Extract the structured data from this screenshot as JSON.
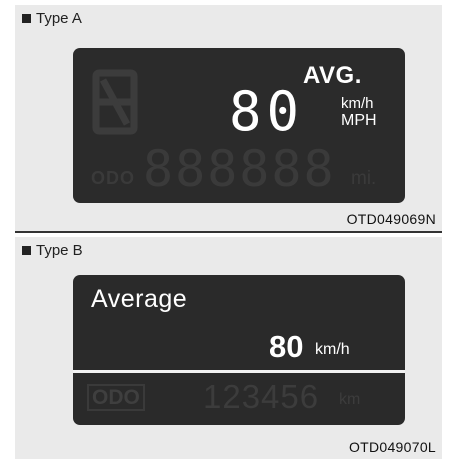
{
  "type_a": {
    "label": "Type A",
    "avg_label": "AVG.",
    "value": "80",
    "unit_km": "km/h",
    "unit_mph": "MPH",
    "odo_label": "ODO",
    "odo_digits": "888888",
    "odo_unit": "mi.",
    "code": "OTD049069N"
  },
  "type_b": {
    "label": "Type B",
    "title": "Average",
    "value": "80",
    "unit": "km/h",
    "odo_label": "ODO",
    "odo_digits": "123456",
    "odo_unit": "km",
    "code": "OTD049070L"
  },
  "colors": {
    "panel_bg": "#eaeaea",
    "screen_bg": "#2b2b2b",
    "lit_text": "#ffffff",
    "unlit_segment": "#3c3c3c"
  }
}
